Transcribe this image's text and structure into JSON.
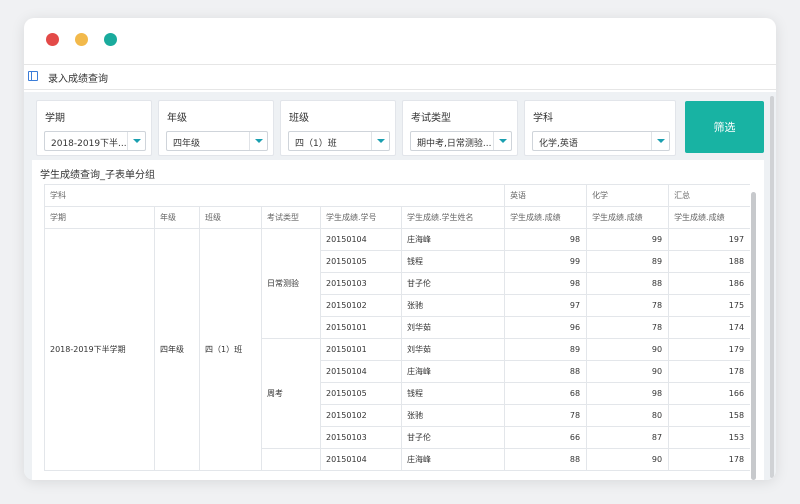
{
  "tab": {
    "label": "录入成绩查询",
    "icon": "panel-icon"
  },
  "filters": [
    {
      "label": "学期",
      "value": "2018-2019下半..."
    },
    {
      "label": "年级",
      "value": "四年级"
    },
    {
      "label": "班级",
      "value": "四（1）班"
    },
    {
      "label": "考试类型",
      "value": "期中考,日常测验..."
    },
    {
      "label": "学科",
      "value": "化学,英语"
    }
  ],
  "filter_button": "筛选",
  "report": {
    "title": "学生成绩查询_子表单分组",
    "header_row1": {
      "subject": "学科",
      "english": "英语",
      "chemistry": "化学",
      "total": "汇总"
    },
    "header_row2": {
      "term": "学期",
      "grade": "年级",
      "class": "班级",
      "exam_type": "考试类型",
      "student_id": "学生成绩.学号",
      "student_name": "学生成绩.学生姓名",
      "english_score": "学生成绩.成绩",
      "chemistry_score": "学生成绩.成绩",
      "total_score": "学生成绩.成绩"
    },
    "group": {
      "term": "2018-2019下半学期",
      "grade": "四年级",
      "class": "四（1）班"
    },
    "exam_groups": [
      {
        "type": "日常测验",
        "rows": [
          {
            "id": "20150104",
            "name": "庄海峰",
            "english": "98",
            "chemistry": "99",
            "total": "197"
          },
          {
            "id": "20150105",
            "name": "钱程",
            "english": "99",
            "chemistry": "89",
            "total": "188"
          },
          {
            "id": "20150103",
            "name": "甘子伦",
            "english": "98",
            "chemistry": "88",
            "total": "186"
          },
          {
            "id": "20150102",
            "name": "张驰",
            "english": "97",
            "chemistry": "78",
            "total": "175"
          },
          {
            "id": "20150101",
            "name": "刘华茹",
            "english": "96",
            "chemistry": "78",
            "total": "174"
          }
        ]
      },
      {
        "type": "周考",
        "rows": [
          {
            "id": "20150101",
            "name": "刘华茹",
            "english": "89",
            "chemistry": "90",
            "total": "179"
          },
          {
            "id": "20150104",
            "name": "庄海峰",
            "english": "88",
            "chemistry": "90",
            "total": "178"
          },
          {
            "id": "20150105",
            "name": "钱程",
            "english": "68",
            "chemistry": "98",
            "total": "166"
          },
          {
            "id": "20150102",
            "name": "张驰",
            "english": "78",
            "chemistry": "80",
            "total": "158"
          },
          {
            "id": "20150103",
            "name": "甘子伦",
            "english": "66",
            "chemistry": "87",
            "total": "153"
          }
        ]
      },
      {
        "type": "",
        "rows": [
          {
            "id": "20150104",
            "name": "庄海峰",
            "english": "88",
            "chemistry": "90",
            "total": "178"
          }
        ]
      }
    ]
  }
}
